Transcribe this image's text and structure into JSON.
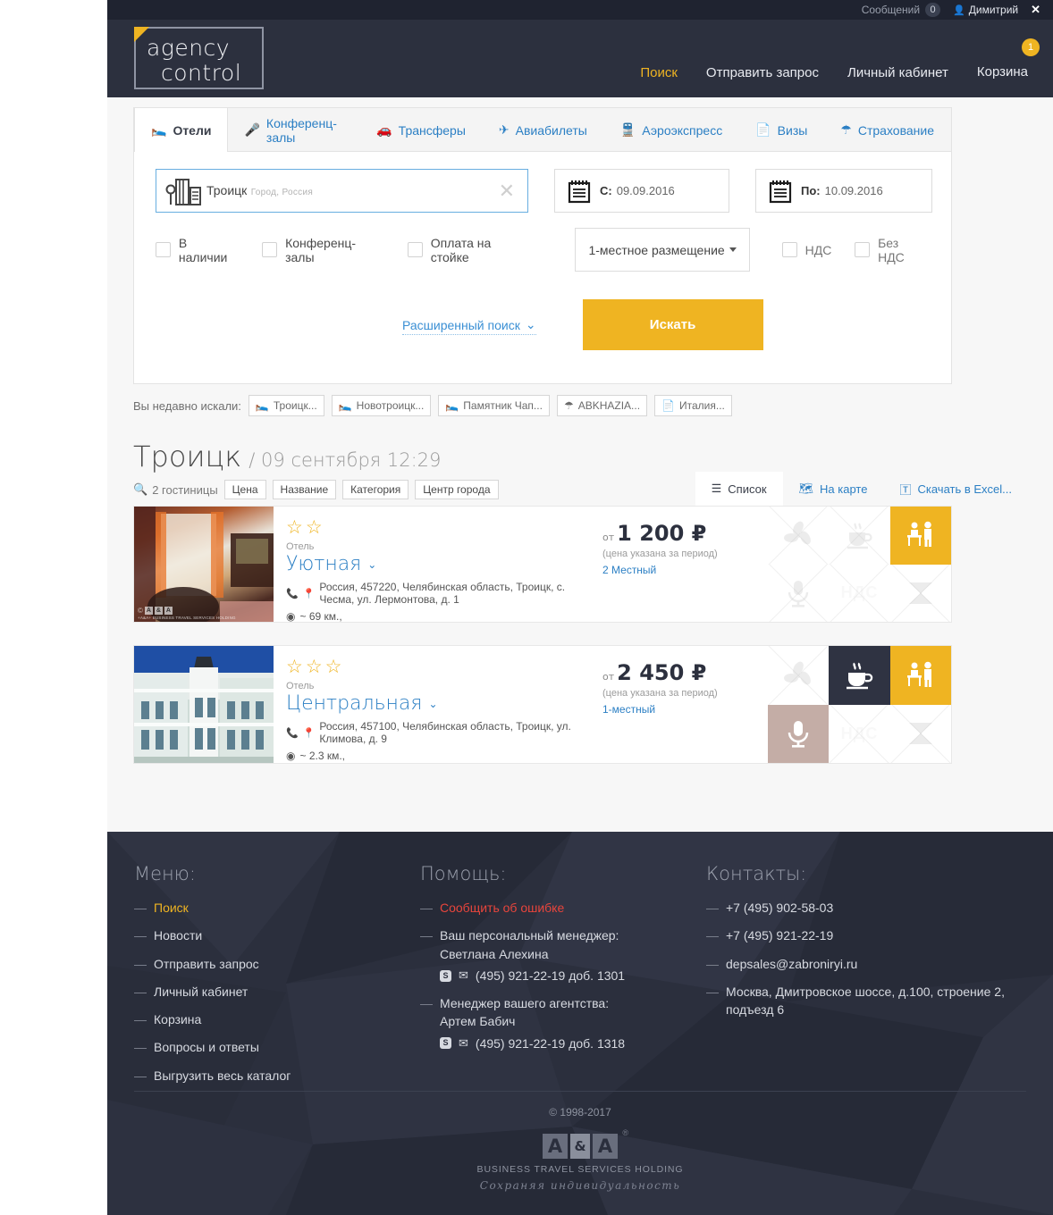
{
  "topbar": {
    "messages_label": "Сообщений",
    "messages_count": "0",
    "user_name": "Димитрий",
    "close_label": "✕"
  },
  "header": {
    "logo_line1": "agency",
    "logo_line2": "control",
    "nav": [
      {
        "label": "Поиск",
        "active": true
      },
      {
        "label": "Отправить запрос",
        "active": false
      },
      {
        "label": "Личный кабинет",
        "active": false
      },
      {
        "label": "Корзина",
        "active": false
      }
    ],
    "cart_badge": "1"
  },
  "tabs": [
    {
      "label": "Отели",
      "icon": "bed-icon",
      "active": true
    },
    {
      "label": "Конференц-залы",
      "icon": "microphone-icon",
      "active": false
    },
    {
      "label": "Трансферы",
      "icon": "car-icon",
      "active": false
    },
    {
      "label": "Авиабилеты",
      "icon": "plane-icon",
      "active": false
    },
    {
      "label": "Аэроэкспресс",
      "icon": "train-icon",
      "active": false
    },
    {
      "label": "Визы",
      "icon": "document-icon",
      "active": false
    },
    {
      "label": "Страхование",
      "icon": "umbrella-icon",
      "active": false
    }
  ],
  "search": {
    "city_value": "Троицк",
    "city_subtitle": "Город, Россия",
    "clear_label": "✕",
    "date_from_label": "С:",
    "date_from_value": "09.09.2016",
    "date_to_label": "По:",
    "date_to_value": "10.09.2016",
    "checkboxes": [
      {
        "label": "В наличии",
        "checked": false
      },
      {
        "label": "Конференц-залы",
        "checked": false
      },
      {
        "label": "Оплата на стойке",
        "checked": false
      }
    ],
    "occupancy_value": "1-местное размещение",
    "vat_checkboxes": [
      {
        "label": "НДС",
        "checked": false
      },
      {
        "label": "Без НДС",
        "checked": false
      }
    ],
    "advanced_label": "Расширенный поиск",
    "submit_label": "Искать"
  },
  "recent": {
    "label": "Вы недавно искали:",
    "items": [
      {
        "label": "Троицк...",
        "icon": "bed-icon"
      },
      {
        "label": "Новотроицк...",
        "icon": "bed-icon"
      },
      {
        "label": "Памятник Чап...",
        "icon": "bed-icon"
      },
      {
        "label": "ABKHAZIA...",
        "icon": "umbrella-icon"
      },
      {
        "label": "Италия...",
        "icon": "document-icon"
      }
    ]
  },
  "results": {
    "city": "Троицк",
    "date_sep": "/ 09 сентября 12:29",
    "count_label": "2 гостиницы",
    "sorts": [
      "Цена",
      "Название",
      "Категория",
      "Центр города"
    ],
    "view_tabs": [
      {
        "label": "Список",
        "icon": "list-icon",
        "active": true
      },
      {
        "label": "На карте",
        "icon": "map-icon",
        "active": false
      },
      {
        "label": "Скачать в Excel...",
        "icon": "excel-icon",
        "active": false
      }
    ]
  },
  "hotels": [
    {
      "stars": 2,
      "type": "Отель",
      "name": "Уютная",
      "address": "Россия, 457220, Челябинская область, Троицк, с. Чесма, ул. Лермонтова, д. 1",
      "distance": "~ 69 км.,",
      "price_prefix": "от",
      "price": "1 200 ₽",
      "price_note": "(цена указана за период)",
      "room_type": "2 Местный",
      "amenities": [
        {
          "name": "air-conditioning-icon",
          "state": "off"
        },
        {
          "name": "coffee-icon",
          "state": "off"
        },
        {
          "name": "reception-icon",
          "state": "yellow"
        },
        {
          "name": "microphone-icon",
          "state": "off"
        },
        {
          "name": "vat-icon",
          "state": "off",
          "text": "НДС"
        },
        {
          "name": "projector-icon",
          "state": "off"
        }
      ]
    },
    {
      "stars": 3,
      "type": "Отель",
      "name": "Центральная",
      "address": "Россия, 457100, Челябинская область, Троицк, ул. Климова, д. 9",
      "distance": "~ 2.3 км.,",
      "price_prefix": "от",
      "price": "2 450 ₽",
      "price_note": "(цена указана за период)",
      "room_type": "1-местный",
      "amenities": [
        {
          "name": "air-conditioning-icon",
          "state": "off"
        },
        {
          "name": "coffee-icon",
          "state": "dark"
        },
        {
          "name": "reception-icon",
          "state": "yellow"
        },
        {
          "name": "microphone-icon",
          "state": "rose"
        },
        {
          "name": "vat-icon",
          "state": "off",
          "text": "НДС"
        },
        {
          "name": "projector-icon",
          "state": "off"
        }
      ]
    }
  ],
  "footer": {
    "menu_title": "Меню:",
    "menu_items": [
      {
        "label": "Поиск",
        "accent": true
      },
      {
        "label": "Новости",
        "accent": false
      },
      {
        "label": "Отправить запрос",
        "accent": false
      },
      {
        "label": "Личный кабинет",
        "accent": false
      },
      {
        "label": "Корзина",
        "accent": false
      },
      {
        "label": "Вопросы и ответы",
        "accent": false
      },
      {
        "label": "Выгрузить весь каталог",
        "accent": false
      }
    ],
    "help_title": "Помощь:",
    "help_error": "Сообщить об ошибке",
    "help_manager_label": "Ваш персональный менеджер:",
    "help_manager_name": "Светлана Алехина",
    "help_manager_phone": "(495) 921-22-19 доб. 1301",
    "help_agency_label": "Менеджер вашего агентства:",
    "help_agency_name": "Артем Бабич",
    "help_agency_phone": "(495) 921-22-19 доб. 1318",
    "contacts_title": "Контакты:",
    "contacts": [
      "+7 (495) 902-58-03",
      "+7 (495) 921-22-19",
      "depsales@zabroniryi.ru",
      "Москва, Дмитровское шоссе, д.100, строение 2, подъезд 6"
    ],
    "copyright": "© 1998-2017",
    "brand_a1": "A",
    "brand_amp": "&",
    "brand_a2": "A",
    "brand_reg": "®",
    "brand_sub": "BUSINESS TRAVEL SERVICES HOLDING",
    "brand_slogan": "Сохраняя индивидуальность"
  },
  "colors": {
    "accent": "#efb422",
    "link": "#2b7fc4",
    "dark": "#2c303e",
    "error": "#e8453c"
  }
}
